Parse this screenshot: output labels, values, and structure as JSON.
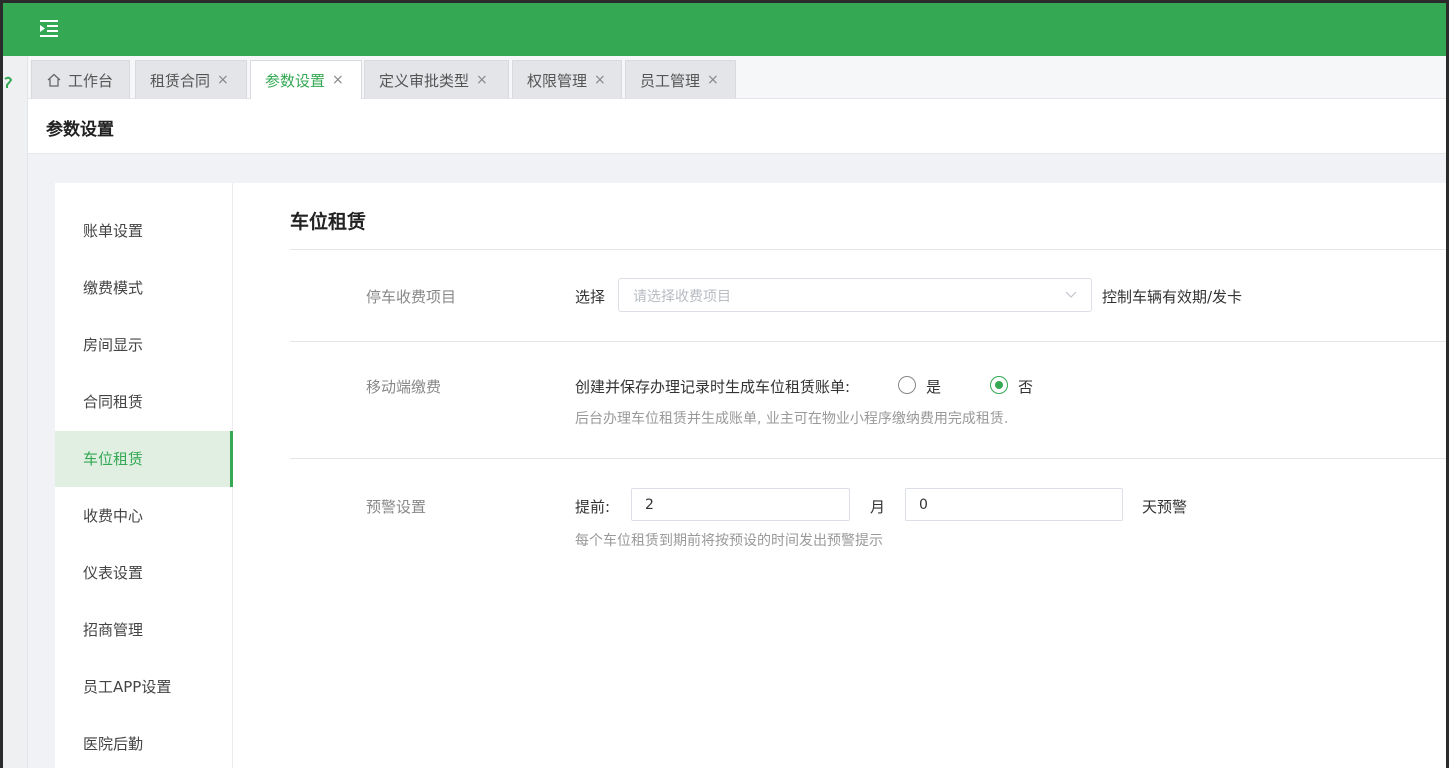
{
  "topbar": {
    "menu_icon": "menu-fold-icon",
    "color": "#34a853"
  },
  "tabs": [
    {
      "label": "工作台",
      "icon": "home-icon",
      "closable": false
    },
    {
      "label": "租赁合同",
      "closable": true
    },
    {
      "label": "参数设置",
      "closable": true,
      "active": true
    },
    {
      "label": "定义审批类型",
      "closable": true
    },
    {
      "label": "权限管理",
      "closable": true
    },
    {
      "label": "员工管理",
      "closable": true
    }
  ],
  "close_glyph": "×",
  "page_title": "参数设置",
  "sidebar": {
    "items": [
      {
        "label": "账单设置"
      },
      {
        "label": "缴费模式"
      },
      {
        "label": "房间显示"
      },
      {
        "label": "合同租赁"
      },
      {
        "label": "车位租赁",
        "active": true
      },
      {
        "label": "收费中心"
      },
      {
        "label": "仪表设置"
      },
      {
        "label": "招商管理"
      },
      {
        "label": "员工APP设置"
      },
      {
        "label": "医院后勤"
      }
    ]
  },
  "section": {
    "title": "车位租赁",
    "parking_fee": {
      "label": "停车收费项目",
      "select_prefix": "选择",
      "placeholder": "请选择收费项目",
      "suffix": "控制车辆有效期/发卡"
    },
    "mobile_pay": {
      "label": "移动端缴费",
      "question": "创建并保存办理记录时生成车位租赁账单:",
      "option_yes": "是",
      "option_no": "否",
      "selected": "否",
      "hint": "后台办理车位租赁并生成账单, 业主可在物业小程序缴纳费用完成租赁."
    },
    "warning": {
      "label": "预警设置",
      "prefix": "提前:",
      "months_value": "2",
      "months_unit": "月",
      "days_value": "0",
      "days_unit": "天预警",
      "hint": "每个车位租赁到期前将按预设的时间发出预警提示"
    }
  },
  "colors": {
    "accent": "#34a853",
    "active_bg": "#e0efe2"
  }
}
